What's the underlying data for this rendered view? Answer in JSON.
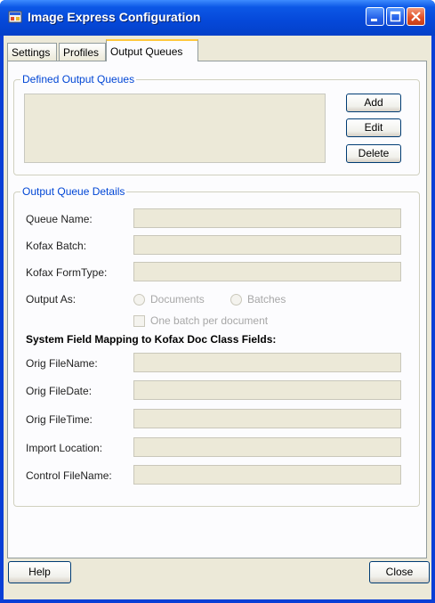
{
  "window": {
    "title": "Image Express Configuration"
  },
  "tabs": [
    {
      "label": "Settings"
    },
    {
      "label": "Profiles"
    },
    {
      "label": "Output Queues"
    }
  ],
  "defined_output_queues": {
    "legend": "Defined Output Queues",
    "buttons": {
      "add": "Add",
      "edit": "Edit",
      "delete": "Delete"
    }
  },
  "output_queue_details": {
    "legend": "Output Queue Details",
    "fields": [
      {
        "label": "Queue Name:",
        "value": ""
      },
      {
        "label": "Kofax Batch:",
        "value": ""
      },
      {
        "label": "Kofax FormType:",
        "value": ""
      }
    ],
    "output_as_label": "Output As:",
    "radio_documents": "Documents",
    "radio_batches": "Batches",
    "checkbox_one_batch": "One batch per document",
    "mapping_heading": "System Field Mapping to Kofax Doc Class Fields:",
    "mapping_fields": [
      {
        "label": "Orig FileName:",
        "value": ""
      },
      {
        "label": "Orig FileDate:",
        "value": ""
      },
      {
        "label": "Orig FileTime:",
        "value": ""
      },
      {
        "label": "Import Location:",
        "value": ""
      },
      {
        "label": "Control FileName:",
        "value": ""
      }
    ]
  },
  "footer": {
    "help": "Help",
    "close": "Close"
  }
}
